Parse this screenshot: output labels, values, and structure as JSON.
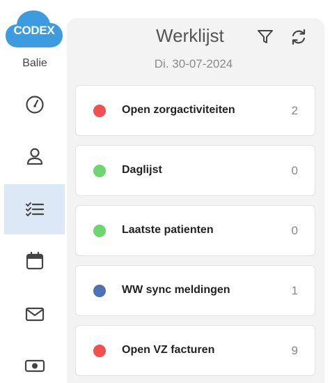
{
  "app": {
    "logo_text": "CODEX",
    "role": "Balie"
  },
  "nav": {
    "items": [
      {
        "icon": "dashboard-gauge-icon",
        "active": false
      },
      {
        "icon": "user-icon",
        "active": false
      },
      {
        "icon": "checklist-icon",
        "active": true
      },
      {
        "icon": "calendar-icon",
        "active": false
      },
      {
        "icon": "mail-icon",
        "active": false
      },
      {
        "icon": "banknote-icon",
        "active": false
      }
    ]
  },
  "worklist": {
    "title": "Werklijst",
    "date": "Di. 30-07-2024",
    "items": [
      {
        "label": "Open zorgactiviteiten",
        "count": "2",
        "status_color": "#f24f4f"
      },
      {
        "label": "Daglijst",
        "count": "0",
        "status_color": "#6fd66f"
      },
      {
        "label": "Laatste patienten",
        "count": "0",
        "status_color": "#6fd66f"
      },
      {
        "label": "WW sync meldingen",
        "count": "1",
        "status_color": "#4d73b5"
      },
      {
        "label": "Open VZ facturen",
        "count": "9",
        "status_color": "#f24f4f"
      }
    ]
  },
  "colors": {
    "brand": "#3d9be0",
    "active_nav_bg": "#dce8f5",
    "panel_bg": "#f3f3f3"
  }
}
